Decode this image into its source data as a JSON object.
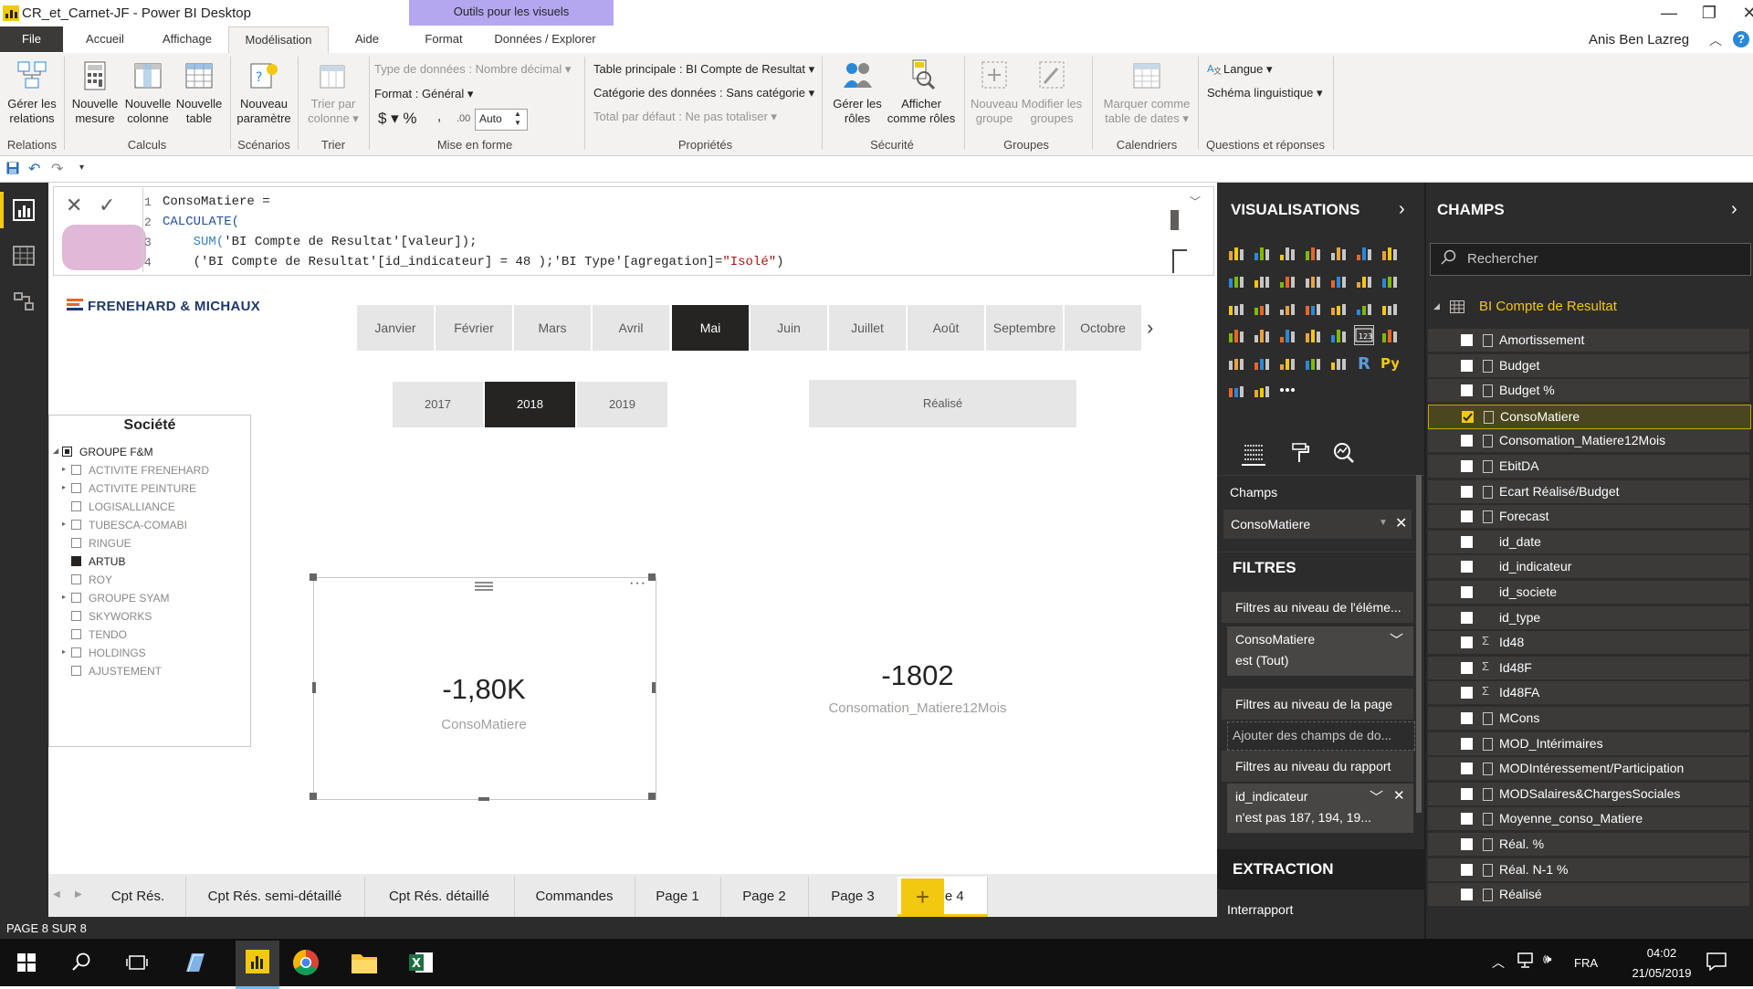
{
  "window": {
    "title": "CR_et_Carnet-JF - Power BI Desktop",
    "tools_header": "Outils pour les visuels",
    "user": "Anis Ben Lazreg"
  },
  "tabs": [
    "File",
    "Accueil",
    "Affichage",
    "Modélisation",
    "Aide",
    "Format",
    "Données / Explorer"
  ],
  "ribbon": {
    "manage_relations": [
      "Gérer les",
      "relations"
    ],
    "new_measure": [
      "Nouvelle",
      "mesure"
    ],
    "new_column": [
      "Nouvelle",
      "colonne"
    ],
    "new_table": [
      "Nouvelle",
      "table"
    ],
    "new_param": [
      "Nouveau",
      "paramètre"
    ],
    "sort_by_col": [
      "Trier par",
      "colonne ▾"
    ],
    "data_type": "Type de données : Nombre décimal ▾",
    "format": "Format : Général ▾",
    "currency": "$ ▾ %",
    "comma": ",",
    "decimals": ".00",
    "auto": "Auto",
    "home_table": "Table principale : BI Compte de Resultat ▾",
    "data_category": "Catégorie des données : Sans catégorie ▾",
    "default_summ": "Total par défaut : Ne pas totaliser ▾",
    "manage_roles": [
      "Gérer les",
      "rôles"
    ],
    "view_as": [
      "Afficher",
      "comme rôles"
    ],
    "new_group": [
      "Nouveau",
      "groupe"
    ],
    "edit_groups": [
      "Modifier les",
      "groupes"
    ],
    "mark_date": [
      "Marquer comme",
      "table de dates ▾"
    ],
    "language": "Langue ▾",
    "schema": "Schéma linguistique ▾",
    "groups": {
      "relations": "Relations",
      "calculs": "Calculs",
      "scenarios": "Scénarios",
      "trier": "Trier",
      "mise_en_forme": "Mise en forme",
      "proprietes": "Propriétés",
      "securite": "Sécurité",
      "groupes": "Groupes",
      "calendriers": "Calendriers",
      "qa": "Questions et réponses"
    }
  },
  "formula": {
    "lines": [
      "1",
      "2",
      "3",
      "4"
    ],
    "l1": "ConsoMatiere =",
    "l2_fn": "CALCULATE(",
    "l3_fn": "SUM(",
    "l3_rest": "'BI Compte de Resultat'[valeur]);",
    "l4_a": "('BI Compte de Resultat'[id_indicateur] = 48 );'BI Type'[agregation]=",
    "l4_str": "\"Isolé\"",
    "l4_end": ")"
  },
  "brand": "FRENEHARD & MICHAUX",
  "months": [
    "Janvier",
    "Février",
    "Mars",
    "Avril",
    "Mai",
    "Juin",
    "Juillet",
    "Août",
    "Septembre",
    "Octobre"
  ],
  "selected_month": "Mai",
  "years": [
    "2017",
    "2018",
    "2019"
  ],
  "selected_year": "2018",
  "real_button": "Réalisé",
  "societe": {
    "title": "Société",
    "root": "GROUPE F&M",
    "items": [
      "ACTIVITE FRENEHARD",
      "ACTIVITE PEINTURE",
      "LOGISALLIANCE",
      "TUBESCA-COMABI",
      "RINGUE",
      "ARTUB",
      "ROY",
      "GROUPE SYAM",
      "SKYWORKS",
      "TENDO",
      "HOLDINGS",
      "AJUSTEMENT"
    ],
    "selected": "ARTUB"
  },
  "cards": [
    {
      "value": "-1,80K",
      "label": "ConsoMatiere"
    },
    {
      "value": "-1802",
      "label": "Consomation_Matiere12Mois"
    }
  ],
  "page_tabs": [
    "Cpt Rés.",
    "Cpt Rés. semi-détaillé",
    "Cpt Rés. détaillé",
    "Commandes",
    "Page 1",
    "Page 2",
    "Page 3",
    "Page 4"
  ],
  "selected_page": "Page 4",
  "status": "PAGE 8 SUR 8",
  "viz_pane": {
    "title": "VISUALISATIONS",
    "champs_label": "Champs",
    "champs_value": "ConsoMatiere",
    "filters_title": "FILTRES",
    "filter_visual": "Filtres au niveau de l'éléme...",
    "filter1_name": "ConsoMatiere",
    "filter1_state": "est (Tout)",
    "filter_page": "Filtres au niveau de la page",
    "filter_page_add": "Ajouter des champs de do...",
    "filter_report": "Filtres au niveau du rapport",
    "filter2_name": "id_indicateur",
    "filter2_state": "n'est pas 187, 194, 19...",
    "extraction": "EXTRACTION",
    "interrapport": "Interrapport"
  },
  "fields_pane": {
    "title": "CHAMPS",
    "search": "Rechercher",
    "table": "BI Compte de Resultat",
    "fields": [
      {
        "name": "Amortissement",
        "kind": "measure",
        "checked": false
      },
      {
        "name": "Budget",
        "kind": "measure",
        "checked": false
      },
      {
        "name": "Budget %",
        "kind": "measure",
        "checked": false
      },
      {
        "name": "ConsoMatiere",
        "kind": "measure",
        "checked": true
      },
      {
        "name": "Consomation_Matiere12Mois",
        "kind": "measure",
        "checked": false
      },
      {
        "name": "EbitDA",
        "kind": "measure",
        "checked": false
      },
      {
        "name": "Ecart Réalisé/Budget",
        "kind": "measure",
        "checked": false
      },
      {
        "name": "Forecast",
        "kind": "measure",
        "checked": false
      },
      {
        "name": "id_date",
        "kind": "column",
        "checked": false
      },
      {
        "name": "id_indicateur",
        "kind": "column",
        "checked": false
      },
      {
        "name": "id_societe",
        "kind": "column",
        "checked": false
      },
      {
        "name": "id_type",
        "kind": "column",
        "checked": false
      },
      {
        "name": "Id48",
        "kind": "sum",
        "checked": false
      },
      {
        "name": "Id48F",
        "kind": "sum",
        "checked": false
      },
      {
        "name": "Id48FA",
        "kind": "sum",
        "checked": false
      },
      {
        "name": "MCons",
        "kind": "measure",
        "checked": false
      },
      {
        "name": "MOD_Intérimaires",
        "kind": "measure",
        "checked": false
      },
      {
        "name": "MODIntéressement/Participation",
        "kind": "measure",
        "checked": false
      },
      {
        "name": "MODSalaires&ChargesSociales",
        "kind": "measure",
        "checked": false
      },
      {
        "name": "Moyenne_conso_Matiere",
        "kind": "measure",
        "checked": false
      },
      {
        "name": "Réal. %",
        "kind": "measure",
        "checked": false
      },
      {
        "name": "Réal. N-1 %",
        "kind": "measure",
        "checked": false
      },
      {
        "name": "Réalisé",
        "kind": "measure",
        "checked": false
      }
    ]
  },
  "taskbar": {
    "lang": "FRA",
    "time": "04:02",
    "date": "21/05/2019"
  }
}
